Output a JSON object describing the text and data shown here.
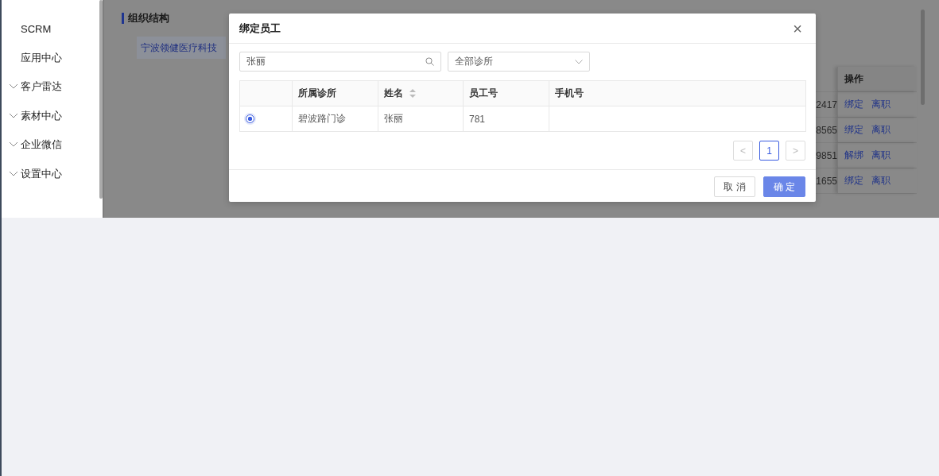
{
  "sidebar": {
    "items": [
      {
        "label": "SCRM",
        "kind": "link"
      },
      {
        "label": "应用中心",
        "kind": "link"
      },
      {
        "label": "客户雷达",
        "kind": "group"
      },
      {
        "label": "素材中心",
        "kind": "group"
      },
      {
        "label": "企业微信",
        "kind": "group"
      },
      {
        "label": "设置中心",
        "kind": "group"
      }
    ]
  },
  "main": {
    "heading": "组织结构",
    "tree": [
      {
        "label": "宁波领健医疗科技",
        "selected": true
      }
    ],
    "table": {
      "columns": [
        "操作"
      ],
      "rows": [
        {
          "column_1": "2417",
          "actions": [
            "绑定",
            "离职"
          ]
        },
        {
          "column_1": "8565",
          "actions": [
            "绑定",
            "离职"
          ]
        },
        {
          "column_1": "9851",
          "actions": [
            "解绑",
            "离职"
          ]
        },
        {
          "column_1": "1655",
          "actions": [
            "绑定",
            "离职"
          ]
        }
      ]
    }
  },
  "modal": {
    "title": "绑定员工",
    "close": "×",
    "search": {
      "value": "张丽"
    },
    "filter": {
      "value": "全部诊所"
    },
    "table": {
      "columns": [
        {
          "label": "所属诊所",
          "sortable": false
        },
        {
          "label": "姓名",
          "sortable": true
        },
        {
          "label": "员工号",
          "sortable": false
        },
        {
          "label": "手机号",
          "sortable": false
        }
      ],
      "rows": [
        {
          "selected": true,
          "cells": [
            "碧波路门诊",
            "张丽",
            "781",
            ""
          ]
        }
      ]
    },
    "pagination": {
      "prev": "<",
      "pages": [
        {
          "label": "1",
          "selected": true
        }
      ],
      "next": ">"
    },
    "buttons": [
      {
        "label": "取 消",
        "kind": "secondary"
      },
      {
        "label": "确 定",
        "kind": "primary"
      }
    ]
  }
}
